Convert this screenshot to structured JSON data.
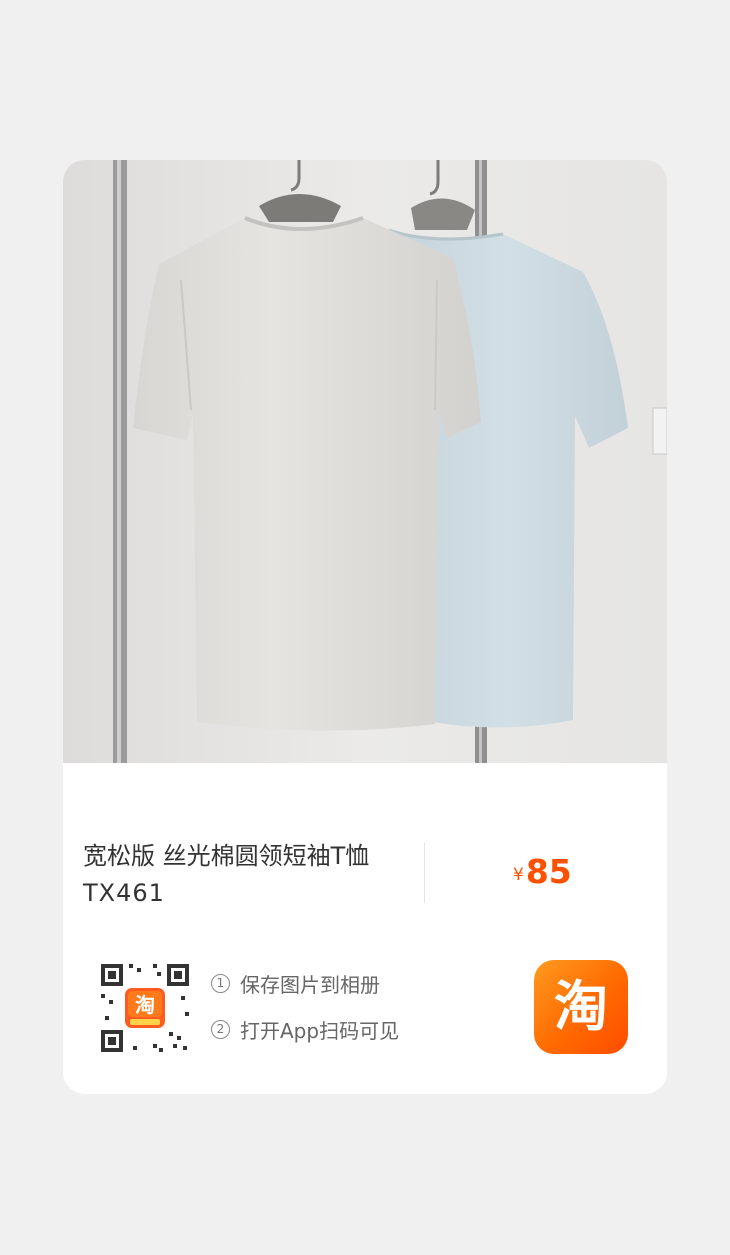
{
  "product": {
    "title": "宽松版 丝光棉圆领短袖T恤",
    "code": "TX461",
    "photo_icon": "product-photo"
  },
  "price": {
    "currency": "¥",
    "amount": "85",
    "color": "#ff5000"
  },
  "share": {
    "qr_icon": "qr-code",
    "qr_badge_text": "淘",
    "steps": [
      {
        "num": "1",
        "text": "保存图片到相册"
      },
      {
        "num": "2",
        "text": "打开App扫码可见"
      }
    ]
  },
  "app_icon": {
    "name": "taobao-icon",
    "glyph": "淘",
    "color": "#ff6a00"
  }
}
